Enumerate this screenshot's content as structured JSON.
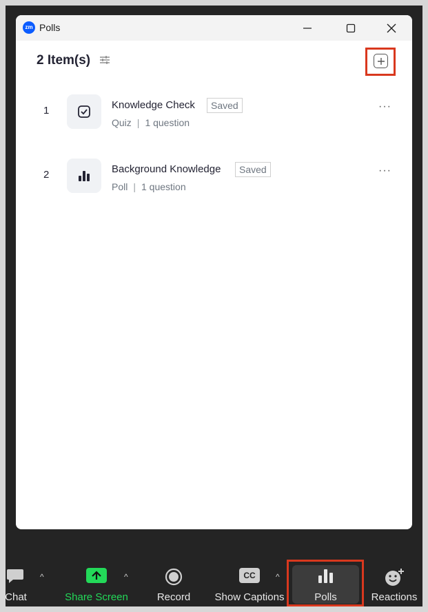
{
  "window": {
    "title": "Polls",
    "logo_text": "zm"
  },
  "header": {
    "title": "2 Item(s)"
  },
  "items": [
    {
      "index": "1",
      "title": "Knowledge Check",
      "status": "Saved",
      "type": "Quiz",
      "questions": "1 question",
      "icon": "checkbox-icon"
    },
    {
      "index": "2",
      "title": "Background Knowledge",
      "status": "Saved",
      "type": "Poll",
      "questions": "1 question",
      "icon": "bar-chart-icon"
    }
  ],
  "toolbar": {
    "chat": "Chat",
    "share_screen": "Share Screen",
    "record": "Record",
    "show_captions": "Show Captions",
    "polls": "Polls",
    "reactions": "Reactions",
    "captions_icon_text": "CC"
  },
  "colors": {
    "accent": "#0b5cff",
    "share_green": "#23d959",
    "highlight": "#d9381e"
  }
}
